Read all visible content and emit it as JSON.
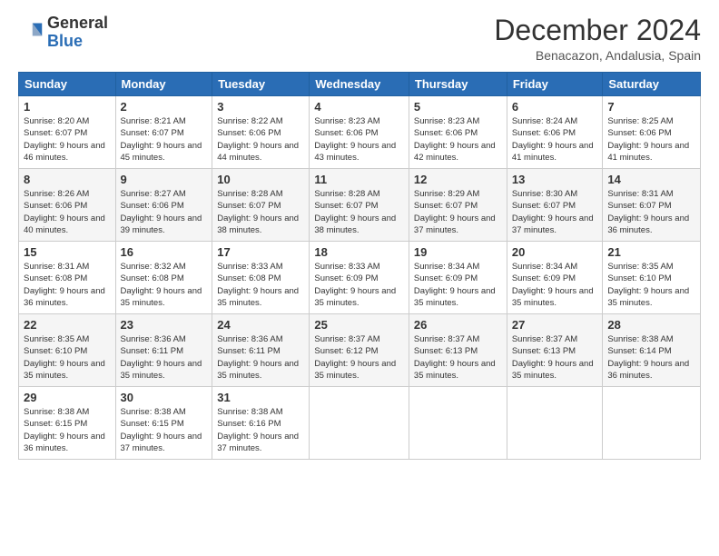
{
  "header": {
    "logo_general": "General",
    "logo_blue": "Blue",
    "month_title": "December 2024",
    "location": "Benacazon, Andalusia, Spain"
  },
  "weekdays": [
    "Sunday",
    "Monday",
    "Tuesday",
    "Wednesday",
    "Thursday",
    "Friday",
    "Saturday"
  ],
  "weeks": [
    [
      {
        "day": "1",
        "sunrise": "8:20 AM",
        "sunset": "6:07 PM",
        "daylight": "9 hours and 46 minutes."
      },
      {
        "day": "2",
        "sunrise": "8:21 AM",
        "sunset": "6:07 PM",
        "daylight": "9 hours and 45 minutes."
      },
      {
        "day": "3",
        "sunrise": "8:22 AM",
        "sunset": "6:06 PM",
        "daylight": "9 hours and 44 minutes."
      },
      {
        "day": "4",
        "sunrise": "8:23 AM",
        "sunset": "6:06 PM",
        "daylight": "9 hours and 43 minutes."
      },
      {
        "day": "5",
        "sunrise": "8:23 AM",
        "sunset": "6:06 PM",
        "daylight": "9 hours and 42 minutes."
      },
      {
        "day": "6",
        "sunrise": "8:24 AM",
        "sunset": "6:06 PM",
        "daylight": "9 hours and 41 minutes."
      },
      {
        "day": "7",
        "sunrise": "8:25 AM",
        "sunset": "6:06 PM",
        "daylight": "9 hours and 41 minutes."
      }
    ],
    [
      {
        "day": "8",
        "sunrise": "8:26 AM",
        "sunset": "6:06 PM",
        "daylight": "9 hours and 40 minutes."
      },
      {
        "day": "9",
        "sunrise": "8:27 AM",
        "sunset": "6:06 PM",
        "daylight": "9 hours and 39 minutes."
      },
      {
        "day": "10",
        "sunrise": "8:28 AM",
        "sunset": "6:07 PM",
        "daylight": "9 hours and 38 minutes."
      },
      {
        "day": "11",
        "sunrise": "8:28 AM",
        "sunset": "6:07 PM",
        "daylight": "9 hours and 38 minutes."
      },
      {
        "day": "12",
        "sunrise": "8:29 AM",
        "sunset": "6:07 PM",
        "daylight": "9 hours and 37 minutes."
      },
      {
        "day": "13",
        "sunrise": "8:30 AM",
        "sunset": "6:07 PM",
        "daylight": "9 hours and 37 minutes."
      },
      {
        "day": "14",
        "sunrise": "8:31 AM",
        "sunset": "6:07 PM",
        "daylight": "9 hours and 36 minutes."
      }
    ],
    [
      {
        "day": "15",
        "sunrise": "8:31 AM",
        "sunset": "6:08 PM",
        "daylight": "9 hours and 36 minutes."
      },
      {
        "day": "16",
        "sunrise": "8:32 AM",
        "sunset": "6:08 PM",
        "daylight": "9 hours and 35 minutes."
      },
      {
        "day": "17",
        "sunrise": "8:33 AM",
        "sunset": "6:08 PM",
        "daylight": "9 hours and 35 minutes."
      },
      {
        "day": "18",
        "sunrise": "8:33 AM",
        "sunset": "6:09 PM",
        "daylight": "9 hours and 35 minutes."
      },
      {
        "day": "19",
        "sunrise": "8:34 AM",
        "sunset": "6:09 PM",
        "daylight": "9 hours and 35 minutes."
      },
      {
        "day": "20",
        "sunrise": "8:34 AM",
        "sunset": "6:09 PM",
        "daylight": "9 hours and 35 minutes."
      },
      {
        "day": "21",
        "sunrise": "8:35 AM",
        "sunset": "6:10 PM",
        "daylight": "9 hours and 35 minutes."
      }
    ],
    [
      {
        "day": "22",
        "sunrise": "8:35 AM",
        "sunset": "6:10 PM",
        "daylight": "9 hours and 35 minutes."
      },
      {
        "day": "23",
        "sunrise": "8:36 AM",
        "sunset": "6:11 PM",
        "daylight": "9 hours and 35 minutes."
      },
      {
        "day": "24",
        "sunrise": "8:36 AM",
        "sunset": "6:11 PM",
        "daylight": "9 hours and 35 minutes."
      },
      {
        "day": "25",
        "sunrise": "8:37 AM",
        "sunset": "6:12 PM",
        "daylight": "9 hours and 35 minutes."
      },
      {
        "day": "26",
        "sunrise": "8:37 AM",
        "sunset": "6:13 PM",
        "daylight": "9 hours and 35 minutes."
      },
      {
        "day": "27",
        "sunrise": "8:37 AM",
        "sunset": "6:13 PM",
        "daylight": "9 hours and 35 minutes."
      },
      {
        "day": "28",
        "sunrise": "8:38 AM",
        "sunset": "6:14 PM",
        "daylight": "9 hours and 36 minutes."
      }
    ],
    [
      {
        "day": "29",
        "sunrise": "8:38 AM",
        "sunset": "6:15 PM",
        "daylight": "9 hours and 36 minutes."
      },
      {
        "day": "30",
        "sunrise": "8:38 AM",
        "sunset": "6:15 PM",
        "daylight": "9 hours and 37 minutes."
      },
      {
        "day": "31",
        "sunrise": "8:38 AM",
        "sunset": "6:16 PM",
        "daylight": "9 hours and 37 minutes."
      },
      null,
      null,
      null,
      null
    ]
  ]
}
